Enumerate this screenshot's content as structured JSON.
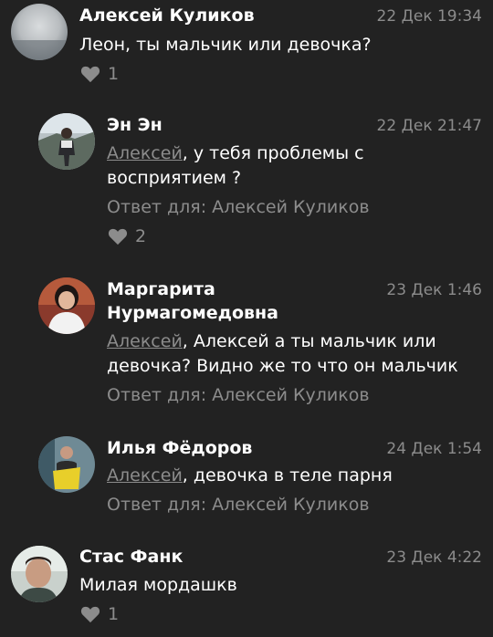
{
  "comments": [
    {
      "name": "Алексей Куликов",
      "time": "22 Дек 19:34",
      "text": "Леон, ты мальчик или девочка?",
      "likes": "1"
    },
    {
      "name": "Эн Эн",
      "time": "22 Дек 21:47",
      "mention": "Алексей",
      "text": ", у тебя проблемы с восприятием ?",
      "reply_to": "Ответ для: Алексей Куликов",
      "likes": "2"
    },
    {
      "name": "Маргарита Нурмагомедовна",
      "time": "23 Дек 1:46",
      "mention": "Алексей",
      "text": ", Алексей а ты мальчик или девочка? Видно же то что он мальчик",
      "reply_to": "Ответ для: Алексей Куликов"
    },
    {
      "name": "Илья Фёдоров",
      "time": "24 Дек 1:54",
      "mention": "Алексей",
      "text": ", девочка в теле парня",
      "reply_to": "Ответ для: Алексей Куликов"
    },
    {
      "name": "Стас Фанк",
      "time": "23 Дек 4:22",
      "text": "Милая мордашкв",
      "likes": "1"
    }
  ],
  "colors": {
    "background": "#222222",
    "text": "#ffffff",
    "muted": "#8c8c8c"
  },
  "icons": {
    "like": "heart-icon"
  }
}
